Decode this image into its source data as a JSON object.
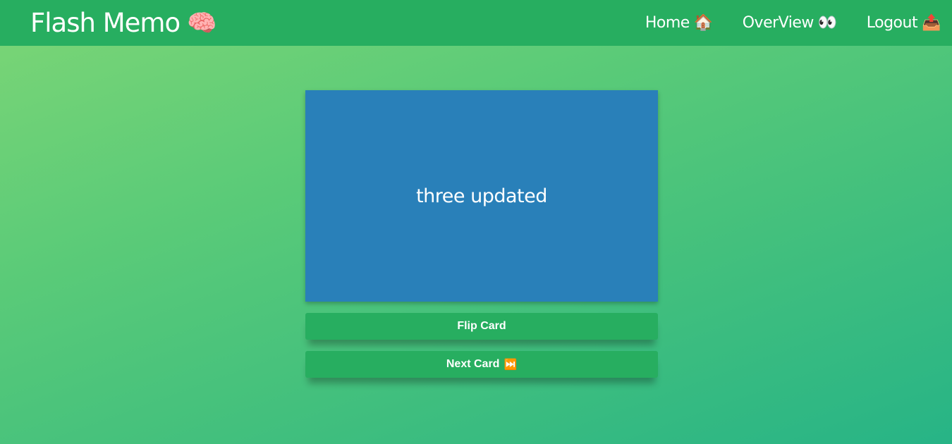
{
  "navbar": {
    "brand": {
      "title": "Flash Memo",
      "icon": "🧠"
    },
    "links": [
      {
        "label": "Home",
        "icon": "🏠"
      },
      {
        "label": "OverView",
        "icon": "👀"
      },
      {
        "label": "Logout",
        "icon": "📤"
      }
    ]
  },
  "card": {
    "text": "three updated"
  },
  "buttons": {
    "flip": {
      "label": "Flip Card"
    },
    "next": {
      "label": "Next Card",
      "icon": "⏭️"
    }
  },
  "colors": {
    "navbar": "#27ae60",
    "card": "#2980b9",
    "button": "#27ae60",
    "text": "#ffffff"
  }
}
